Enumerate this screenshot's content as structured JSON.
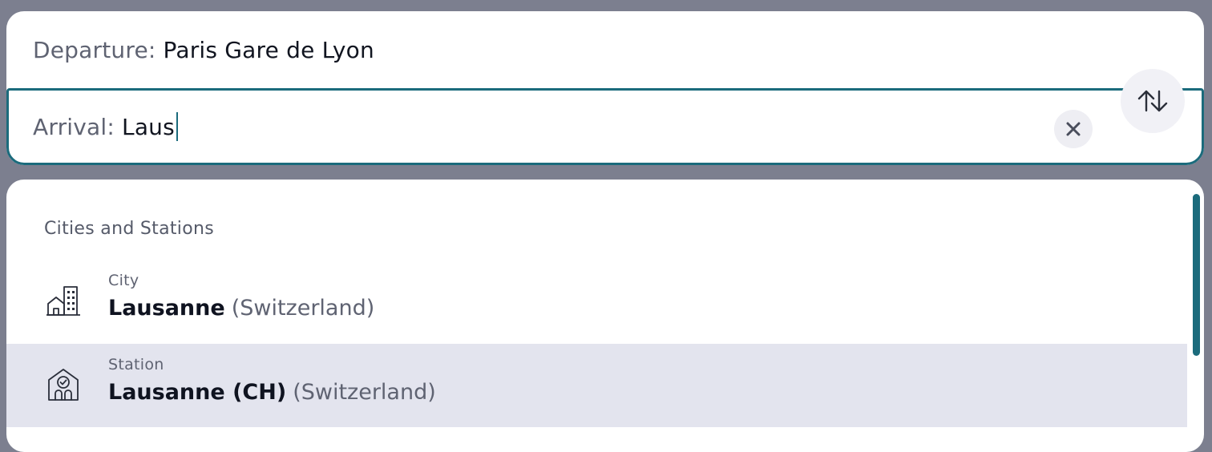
{
  "search": {
    "departure": {
      "label": "Departure:",
      "value": "Paris Gare de Lyon"
    },
    "arrival": {
      "label": "Arrival:",
      "value": "Laus"
    },
    "clear_icon": "close-icon",
    "swap_icon": "swap-vertical-icon"
  },
  "suggestions": {
    "section_title": "Cities and Stations",
    "items": [
      {
        "type": "City",
        "name": "Lausanne",
        "country": "(Switzerland)",
        "icon": "city-buildings-icon",
        "selected": false
      },
      {
        "type": "Station",
        "name": "Lausanne (CH)",
        "country": "(Switzerland)",
        "icon": "station-icon",
        "selected": true
      }
    ]
  },
  "colors": {
    "accent": "#1b6b7c",
    "backdrop": "#7c7f8f",
    "selected_row": "#e3e4ee"
  }
}
